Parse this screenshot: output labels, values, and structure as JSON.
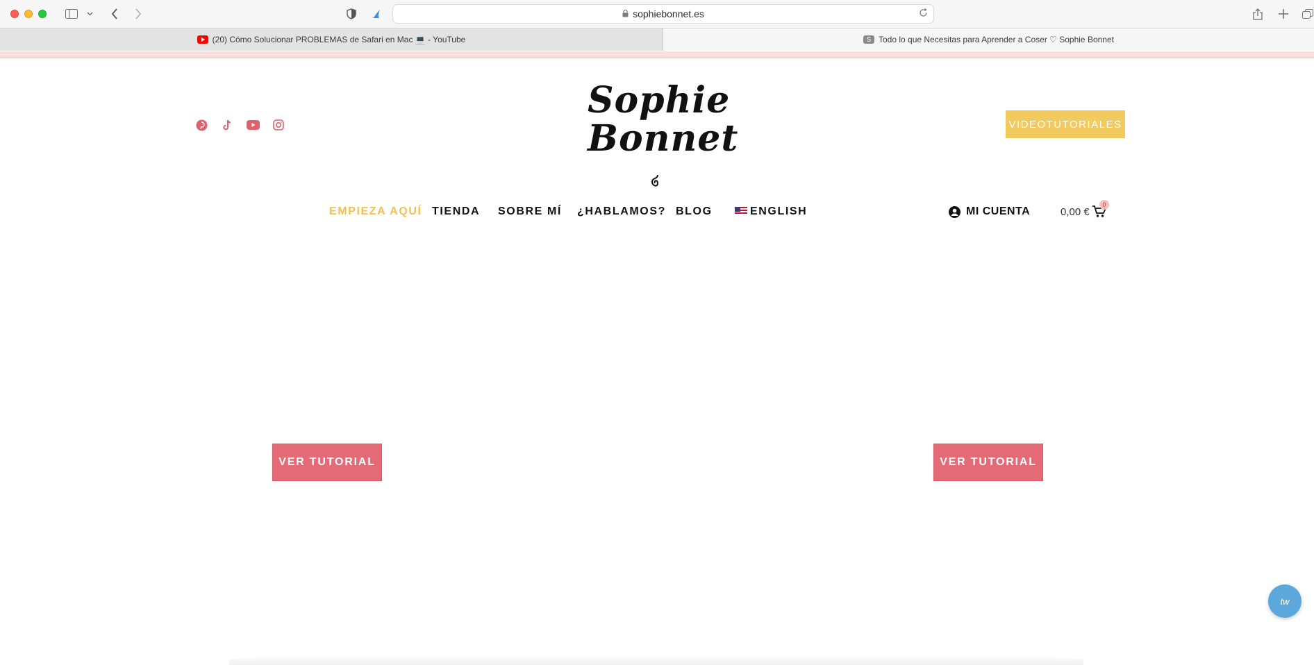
{
  "browser": {
    "url": "sophiebonnet.es",
    "tabs": [
      {
        "title": "(20) Cómo Solucionar PROBLEMAS de Safari en Mac 💻 - YouTube",
        "favicon": "youtube-icon"
      },
      {
        "title": "Todo lo que Necesitas para Aprender a Coser ♡ Sophie Bonnet",
        "favicon": "s-icon"
      }
    ]
  },
  "header": {
    "logo_line1": "Sophie",
    "logo_line2": "Bonnet",
    "cta_label": "VIDEOTUTORIALES",
    "social_icons": [
      "pinterest-icon",
      "tiktok-icon",
      "youtube-icon",
      "instagram-icon"
    ]
  },
  "nav": {
    "items": [
      {
        "label": "EMPIEZA AQUÍ",
        "active": true
      },
      {
        "label": "TIENDA"
      },
      {
        "label": "SOBRE MÍ"
      },
      {
        "label": "¿HABLAMOS?"
      },
      {
        "label": "BLOG"
      },
      {
        "label": "ENGLISH"
      }
    ],
    "account_label": "MI CUENTA",
    "cart_total": "0,00 €",
    "cart_count": "0"
  },
  "main": {
    "tutorial_button_1": "VER TUTORIAL",
    "tutorial_button_2": "VER TUTORIAL"
  },
  "chat": {
    "label": "tw"
  },
  "colors": {
    "accent_yellow": "#f2ca5e",
    "accent_pink": "#e46b76",
    "social_pink": "#e0606e",
    "chat_blue": "#5ca8dc"
  }
}
